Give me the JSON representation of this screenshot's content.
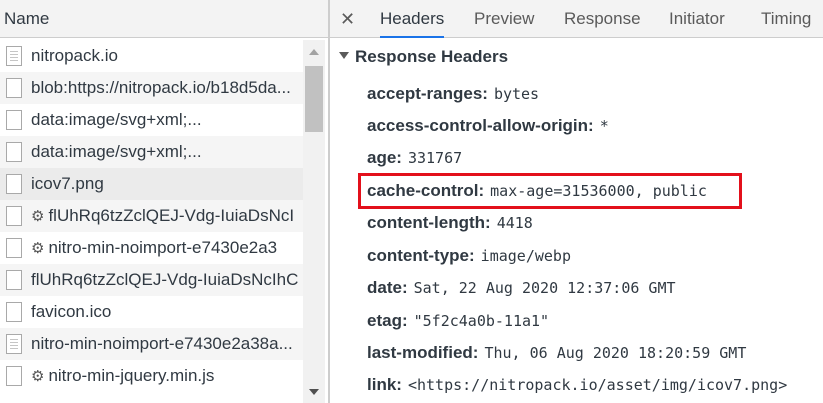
{
  "network_list": {
    "column_header": "Name",
    "rows": [
      {
        "label": "nitropack.io",
        "icon": "document-icon",
        "gear": false
      },
      {
        "label": "blob:https://nitropack.io/b18d5da...",
        "icon": "file-icon",
        "gear": false
      },
      {
        "label": "data:image/svg+xml;...",
        "icon": "file-icon",
        "gear": false
      },
      {
        "label": "data:image/svg+xml;...",
        "icon": "file-icon",
        "gear": false
      },
      {
        "label": "icov7.png",
        "icon": "file-icon",
        "gear": false
      },
      {
        "label": "flUhRq6tzZclQEJ-Vdg-IuiaDsNcI",
        "icon": "file-icon",
        "gear": true
      },
      {
        "label": "nitro-min-noimport-e7430e2a3",
        "icon": "file-icon",
        "gear": true
      },
      {
        "label": "flUhRq6tzZclQEJ-Vdg-IuiaDsNcIhC",
        "icon": "file-icon",
        "gear": false
      },
      {
        "label": "favicon.ico",
        "icon": "file-icon",
        "gear": false
      },
      {
        "label": "nitro-min-noimport-e7430e2a38a...",
        "icon": "document-icon",
        "gear": false
      },
      {
        "label": "nitro-min-jquery.min.js",
        "icon": "file-icon",
        "gear": true
      }
    ]
  },
  "detail_tabs": {
    "close_glyph": "✕",
    "tabs": [
      "Headers",
      "Preview",
      "Response",
      "Initiator",
      "Timing"
    ],
    "active": "Headers"
  },
  "response_headers": {
    "title": "Response Headers",
    "items": [
      {
        "key": "accept-ranges:",
        "value": "bytes"
      },
      {
        "key": "access-control-allow-origin:",
        "value": "*"
      },
      {
        "key": "age:",
        "value": "331767"
      },
      {
        "key": "cache-control:",
        "value": "max-age=31536000, public"
      },
      {
        "key": "content-length:",
        "value": "4418"
      },
      {
        "key": "content-type:",
        "value": "image/webp"
      },
      {
        "key": "date:",
        "value": "Sat, 22 Aug 2020 12:37:06 GMT"
      },
      {
        "key": "etag:",
        "value": "\"5f2c4a0b-11a1\""
      },
      {
        "key": "last-modified:",
        "value": "Thu, 06 Aug 2020 18:20:59 GMT"
      },
      {
        "key": "link:",
        "value": "<https://nitropack.io/asset/img/icov7.png>"
      }
    ]
  },
  "colors": {
    "active_tab_underline": "#1a73e8",
    "highlight_border": "#e3101b"
  }
}
